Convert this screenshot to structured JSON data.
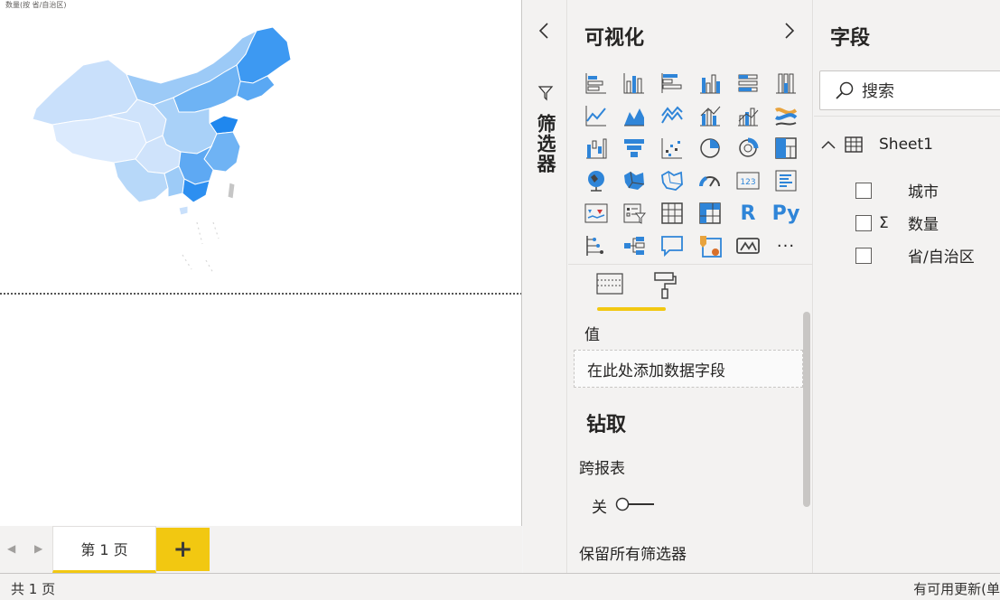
{
  "canvas": {
    "map_title": "数量(按 省/自治区)"
  },
  "pages": {
    "tab_label": "第 1 页",
    "add_label": "+"
  },
  "status": {
    "left": "共 1 页",
    "right": "有可用更新(单"
  },
  "filters": {
    "label": "筛选器",
    "collapse_icon": "chevron-left",
    "funnel_icon": "funnel"
  },
  "viz": {
    "title": "可视化",
    "expand_icon": "chevron-right",
    "r_label": "R",
    "py_label": "Py",
    "more_label": "···",
    "values_label": "值",
    "values_placeholder": "在此处添加数据字段",
    "drill_title": "钻取",
    "cross_report_label": "跨报表",
    "toggle_state_label": "关",
    "keep_filters_label": "保留所有筛选器",
    "accent_color": "#f2c811"
  },
  "fields": {
    "title": "字段",
    "search_placeholder": "搜索",
    "table_name": "Sheet1",
    "items": [
      {
        "name": "城市",
        "sigma": ""
      },
      {
        "name": "数量",
        "sigma": "Σ"
      },
      {
        "name": "省/自治区",
        "sigma": ""
      }
    ]
  }
}
